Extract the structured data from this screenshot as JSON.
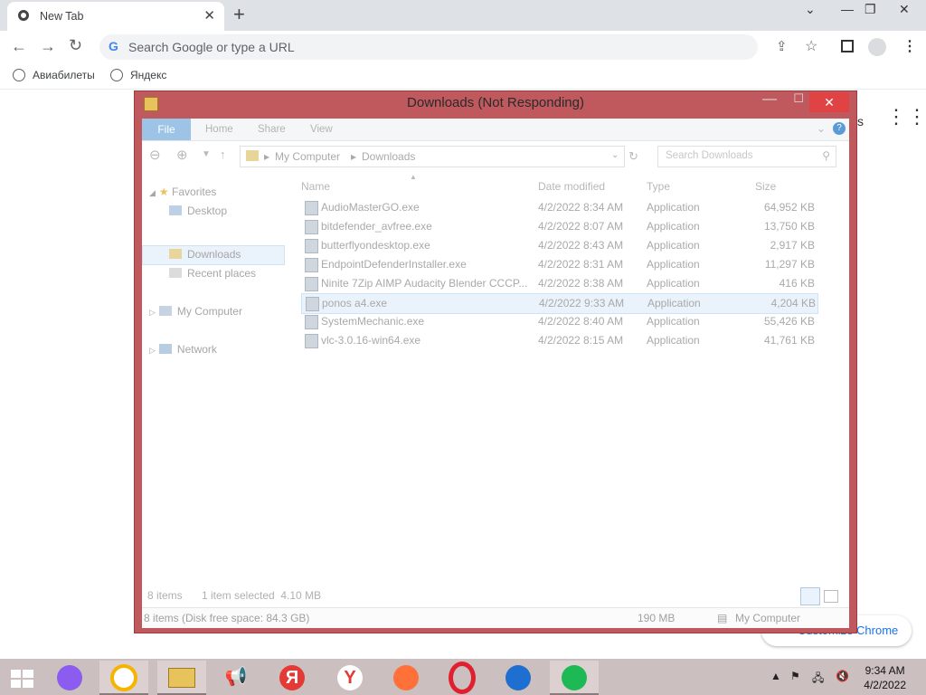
{
  "chrome": {
    "tab_title": "New Tab",
    "omnibox_placeholder": "Search Google or type a URL",
    "bookmarks": [
      {
        "label": "Авиабилеты"
      },
      {
        "label": "Яндекс"
      }
    ],
    "apps_partial_text": "s",
    "customize_label": "Customize Chrome"
  },
  "explorer": {
    "title": "Downloads (Not Responding)",
    "ribbon_tabs": [
      "File",
      "Home",
      "Share",
      "View"
    ],
    "breadcrumb": [
      "My Computer",
      "Downloads"
    ],
    "search_placeholder": "Search Downloads",
    "nav": {
      "favorites": "Favorites",
      "desktop": "Desktop",
      "downloads": "Downloads",
      "recent": "Recent places",
      "my_computer": "My Computer",
      "network": "Network"
    },
    "columns": [
      "Name",
      "Date modified",
      "Type",
      "Size"
    ],
    "files": [
      {
        "name": "AudioMasterGO.exe",
        "date": "4/2/2022 8:34 AM",
        "type": "Application",
        "size": "64,952 KB"
      },
      {
        "name": "bitdefender_avfree.exe",
        "date": "4/2/2022 8:07 AM",
        "type": "Application",
        "size": "13,750 KB"
      },
      {
        "name": "butterflyondesktop.exe",
        "date": "4/2/2022 8:43 AM",
        "type": "Application",
        "size": "2,917 KB"
      },
      {
        "name": "EndpointDefenderInstaller.exe",
        "date": "4/2/2022 8:31 AM",
        "type": "Application",
        "size": "11,297 KB"
      },
      {
        "name": "Ninite 7Zip AIMP Audacity Blender CCCP...",
        "date": "4/2/2022 8:38 AM",
        "type": "Application",
        "size": "416 KB"
      },
      {
        "name": "ponos a4.exe",
        "date": "4/2/2022 9:33 AM",
        "type": "Application",
        "size": "4,204 KB"
      },
      {
        "name": "SystemMechanic.exe",
        "date": "4/2/2022 8:40 AM",
        "type": "Application",
        "size": "55,426 KB"
      },
      {
        "name": "vlc-3.0.16-win64.exe",
        "date": "4/2/2022 8:15 AM",
        "type": "Application",
        "size": "41,761 KB"
      }
    ],
    "selected_index": 5,
    "status_items": "8 items",
    "status_selected": "1 item selected  4.10 MB",
    "bottom_left": "8 items (Disk free space: 84.3 GB)",
    "bottom_size": "190 MB",
    "bottom_location": "My Computer"
  },
  "taskbar": {
    "time": "9:34 AM",
    "date": "4/2/2022"
  }
}
